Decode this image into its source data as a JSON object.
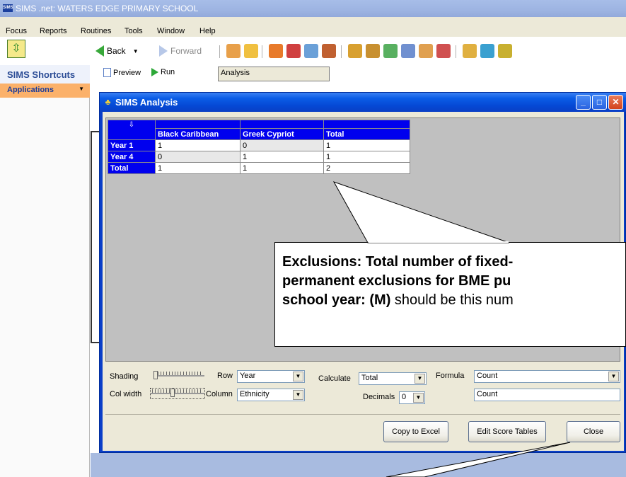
{
  "app": {
    "title": "SIMS .net: WATERS EDGE PRIMARY SCHOOL",
    "logo_text": "SIMS"
  },
  "menu": [
    "Focus",
    "Reports",
    "Routines",
    "Tools",
    "Window",
    "Help"
  ],
  "toolbar": {
    "back_label": "Back",
    "forward_label": "Forward"
  },
  "sidebar": {
    "header": "SIMS Shortcuts",
    "applications": "Applications"
  },
  "subbar": {
    "preview_label": "Preview",
    "run_label": "Run",
    "analysis_value": "Analysis"
  },
  "dialog": {
    "title": "SIMS Analysis",
    "table": {
      "corner_icon": "down-arrow",
      "columns": [
        "Black Caribbean",
        "Greek Cypriot",
        "Total"
      ],
      "rows": [
        {
          "label": "Year  1",
          "values": [
            "1",
            "0",
            "1"
          ]
        },
        {
          "label": "Year  4",
          "values": [
            "0",
            "1",
            "1"
          ]
        },
        {
          "label": "Total",
          "values": [
            "1",
            "1",
            "2"
          ]
        }
      ]
    },
    "controls": {
      "shading_label": "Shading",
      "colwidth_label": "Col width",
      "row_label": "Row",
      "row_value": "Year",
      "column_label": "Column",
      "column_value": "Ethnicity",
      "calculate_label": "Calculate",
      "calculate_value": "Total",
      "decimals_label": "Decimals",
      "decimals_value": "0",
      "formula_label": "Formula",
      "formula_value": "Count",
      "formula_text": "Count"
    },
    "buttons": {
      "copy_excel": "Copy to Excel",
      "edit_score": "Edit Score Tables",
      "close": "Close"
    }
  },
  "callout": {
    "line1": "Exclusions: Total number of fixed-",
    "line2": "permanent exclusions for BME pu",
    "line3_bold": "school year: (M)",
    "line3_normal": " should be this num"
  }
}
